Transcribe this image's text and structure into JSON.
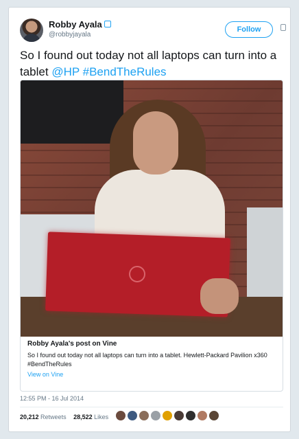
{
  "author": {
    "name": "Robby Ayala",
    "handle": "@robbyjayala",
    "avatar_icon": "profile-avatar-icon"
  },
  "follow_label": "Follow",
  "tweet": {
    "text_plain": "So I found out today not all laptops can turn into a tablet ",
    "mention": "@HP",
    "hashtag": "#BendTheRules"
  },
  "media": {
    "title": "Robby Ayala's post on Vine",
    "description": "So I found out today not all laptops can turn into a tablet. Hewlett-Packard Pavilion x360 #BendTheRules",
    "link": "View on Vine"
  },
  "timestamp": "12:55 PM - 16 Jul 2014",
  "stats": {
    "retweets_count": "20,212",
    "retweets_label": "Retweets",
    "likes_count": "28,522",
    "likes_label": "Likes"
  },
  "colors": {
    "accent": "#1da1f2",
    "text": "#14171a",
    "muted": "#657786"
  },
  "liker_colors": [
    "#6b4b3e",
    "#3d5a80",
    "#8a6d5a",
    "#9aa0a6",
    "#e0a000",
    "#4a3b36",
    "#2f2f2f",
    "#b07a62",
    "#5b4636"
  ]
}
